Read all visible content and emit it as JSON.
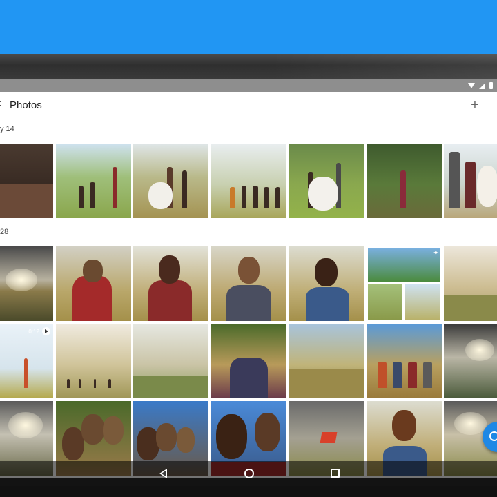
{
  "app": {
    "title": "Photos"
  },
  "toolbar": {
    "add_label": "+"
  },
  "sections": [
    {
      "label": "y 14"
    },
    {
      "label": "28"
    }
  ],
  "video": {
    "duration": "0:12"
  },
  "colors": {
    "backdrop": "#2196f3",
    "fab": "#1e88e5",
    "status_bar": "#8e8e8e"
  },
  "icons": {
    "menu": "menu-icon",
    "add": "add-icon",
    "fab": "fab-icon",
    "back": "back-icon",
    "home": "home-icon",
    "recents": "recents-icon"
  }
}
